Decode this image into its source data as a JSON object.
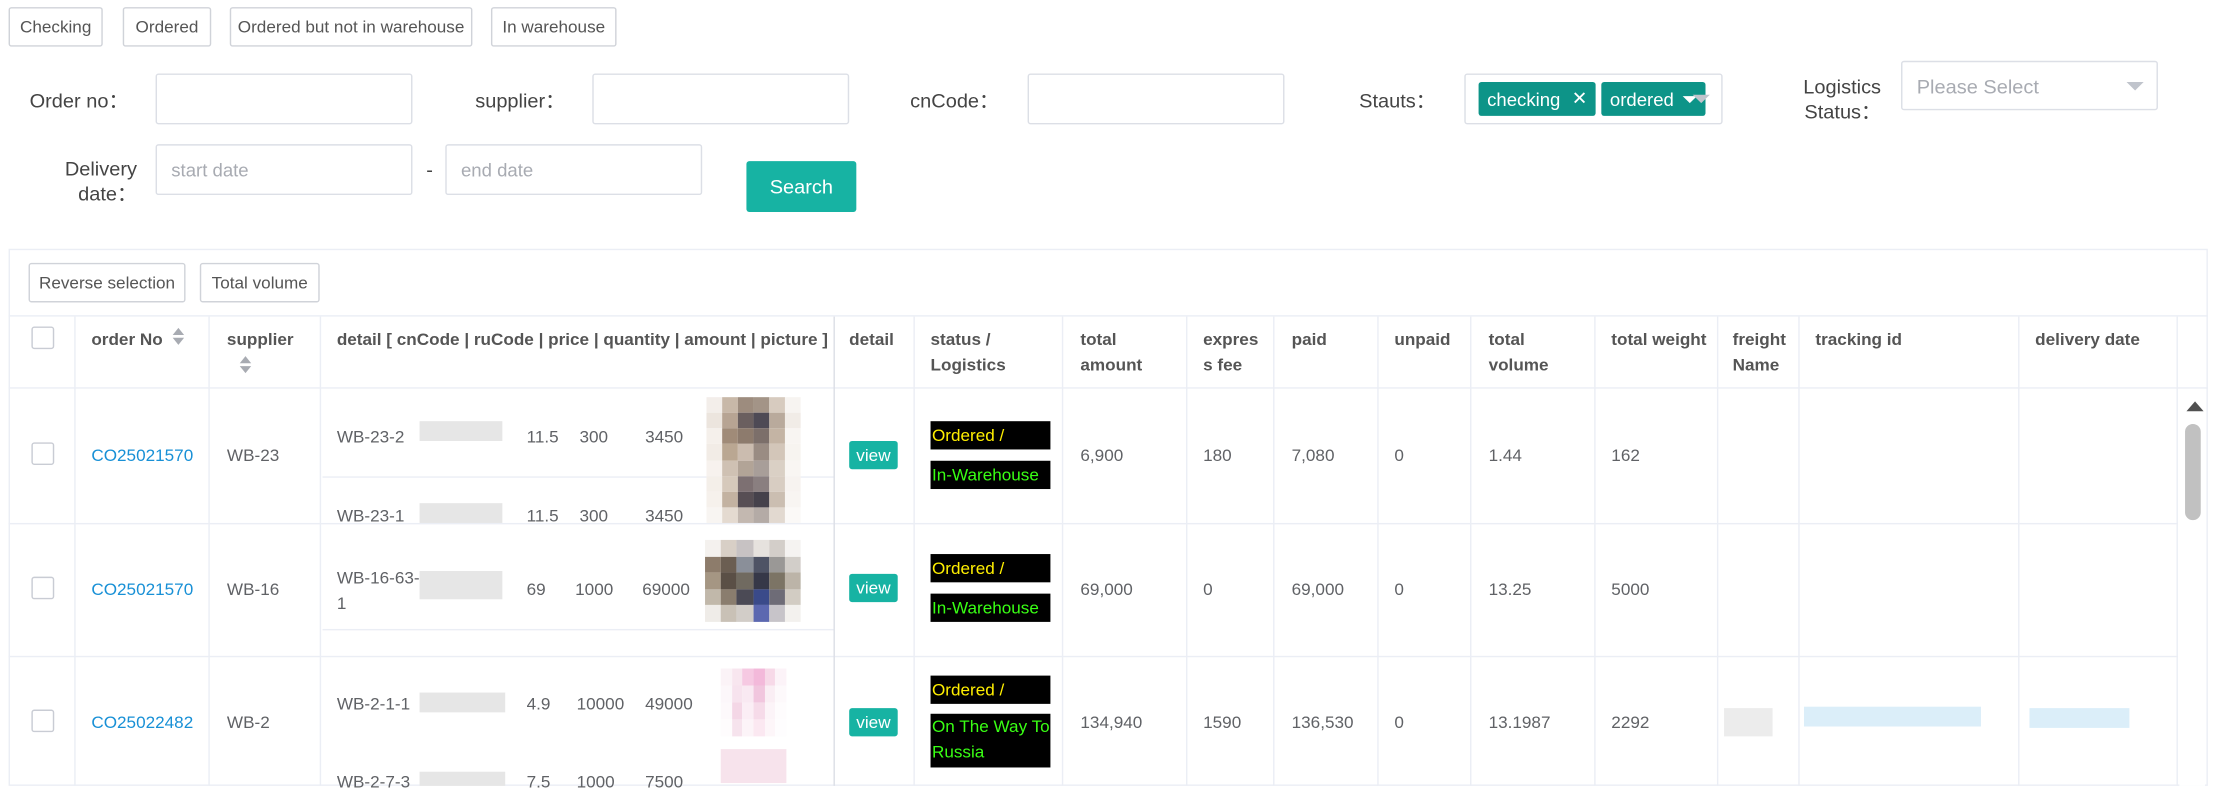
{
  "filter_tabs": [
    "Checking",
    "Ordered",
    "Ordered but not in warehouse",
    "In warehouse"
  ],
  "form": {
    "order_no_label": "Order no：",
    "supplier_label": "supplier：",
    "cncode_label": "cnCode：",
    "status_label": "Stauts：",
    "logistics_label_1": "Logistics",
    "logistics_label_2": "Status：",
    "logistics_placeholder": "Please Select",
    "status_tags": [
      "checking",
      "ordered"
    ],
    "delivery_label_1": "Delivery",
    "delivery_label_2": "date：",
    "start_placeholder": "start date",
    "end_placeholder": "end date",
    "date_separator": "-",
    "search_label": "Search"
  },
  "toolbar": {
    "reverse_label": "Reverse selection",
    "volume_label": "Total volume"
  },
  "table": {
    "headers": {
      "order_no": "order No",
      "supplier": "supplier",
      "detail_list": "detail [ cnCode | ruCode | price | quantity | amount | picture ]",
      "detail": "detail",
      "status_1": "status /",
      "status_2": "Logistics",
      "total_amount_1": "total",
      "total_amount_2": "amount",
      "express_fee_1": "expres",
      "express_fee_2": "s fee",
      "paid": "paid",
      "unpaid": "unpaid",
      "total_volume_1": "total",
      "total_volume_2": "volume",
      "total_weight": "total weight",
      "freight_name_1": "freight",
      "freight_name_2": "Name",
      "tracking_id": "tracking id",
      "delivery_date": "delivery date"
    },
    "view_label": "view",
    "rows": [
      {
        "order_no": "CO25021570",
        "supplier": "WB-23",
        "details": [
          {
            "cncode": "WB-23-2",
            "price": "11.5",
            "quantity": "300",
            "amount": "3450"
          },
          {
            "cncode": "WB-23-1",
            "price": "11.5",
            "quantity": "300",
            "amount": "3450"
          }
        ],
        "status": "Ordered /",
        "logistics": "In-Warehouse",
        "total_amount": "6,900",
        "express_fee": "180",
        "paid": "7,080",
        "unpaid": "0",
        "total_volume": "1.44",
        "total_weight": "162"
      },
      {
        "order_no": "CO25021570",
        "supplier": "WB-16",
        "details": [
          {
            "cncode_1": "WB-16-63-",
            "cncode_2": "1",
            "price": "69",
            "quantity": "1000",
            "amount": "69000"
          }
        ],
        "status": "Ordered /",
        "logistics": "In-Warehouse",
        "total_amount": "69,000",
        "express_fee": "0",
        "paid": "69,000",
        "unpaid": "0",
        "total_volume": "13.25",
        "total_weight": "5000"
      },
      {
        "order_no": "CO25022482",
        "supplier": "WB-2",
        "details": [
          {
            "cncode": "WB-2-1-1",
            "price": "4.9",
            "quantity": "10000",
            "amount": "49000"
          },
          {
            "cncode": "WB-2-7-3",
            "price": "7.5",
            "quantity": "1000",
            "amount": "7500"
          }
        ],
        "status": "Ordered /",
        "logistics_1": "On The Way To",
        "logistics_2": "Russia",
        "total_amount": "134,940",
        "express_fee": "1590",
        "paid": "136,530",
        "unpaid": "0",
        "total_volume": "13.1987",
        "total_weight": "2292"
      }
    ]
  },
  "colors": {
    "accent": "#17b3a3",
    "tag": "#0d9488",
    "link": "#1890d6",
    "status_yellow": "#ffef00",
    "status_green": "#39ff14"
  }
}
